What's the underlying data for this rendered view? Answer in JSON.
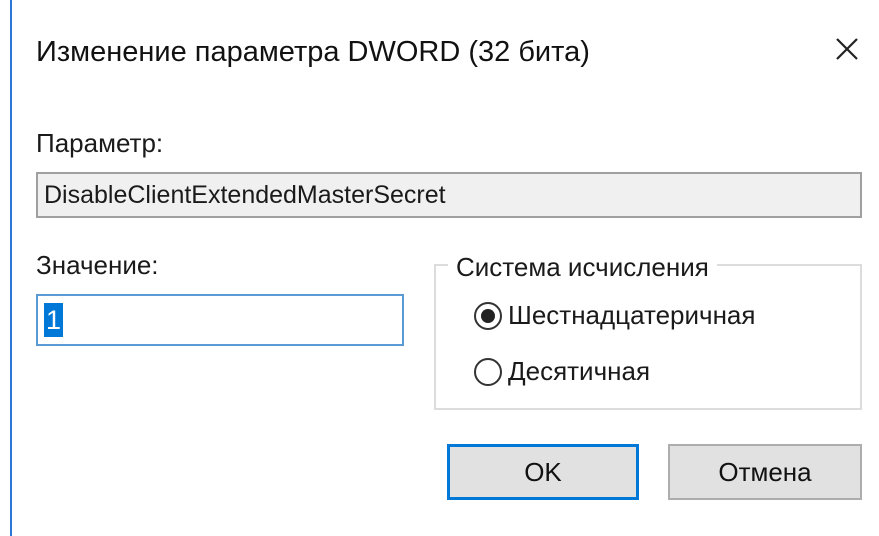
{
  "window": {
    "title": "Изменение параметра DWORD (32 бита)",
    "accent_color": "#0078d7"
  },
  "parameter": {
    "label": "Параметр:",
    "value": "DisableClientExtendedMasterSecret"
  },
  "value": {
    "label": "Значение:",
    "input_value": "1"
  },
  "base": {
    "title": "Система исчисления",
    "options": [
      {
        "label": "Шестнадцатеричная",
        "selected": true
      },
      {
        "label": "Десятичная",
        "selected": false
      }
    ]
  },
  "buttons": {
    "ok_label": "OK",
    "cancel_label": "Отмена"
  },
  "icons": {
    "close": "close-icon"
  }
}
